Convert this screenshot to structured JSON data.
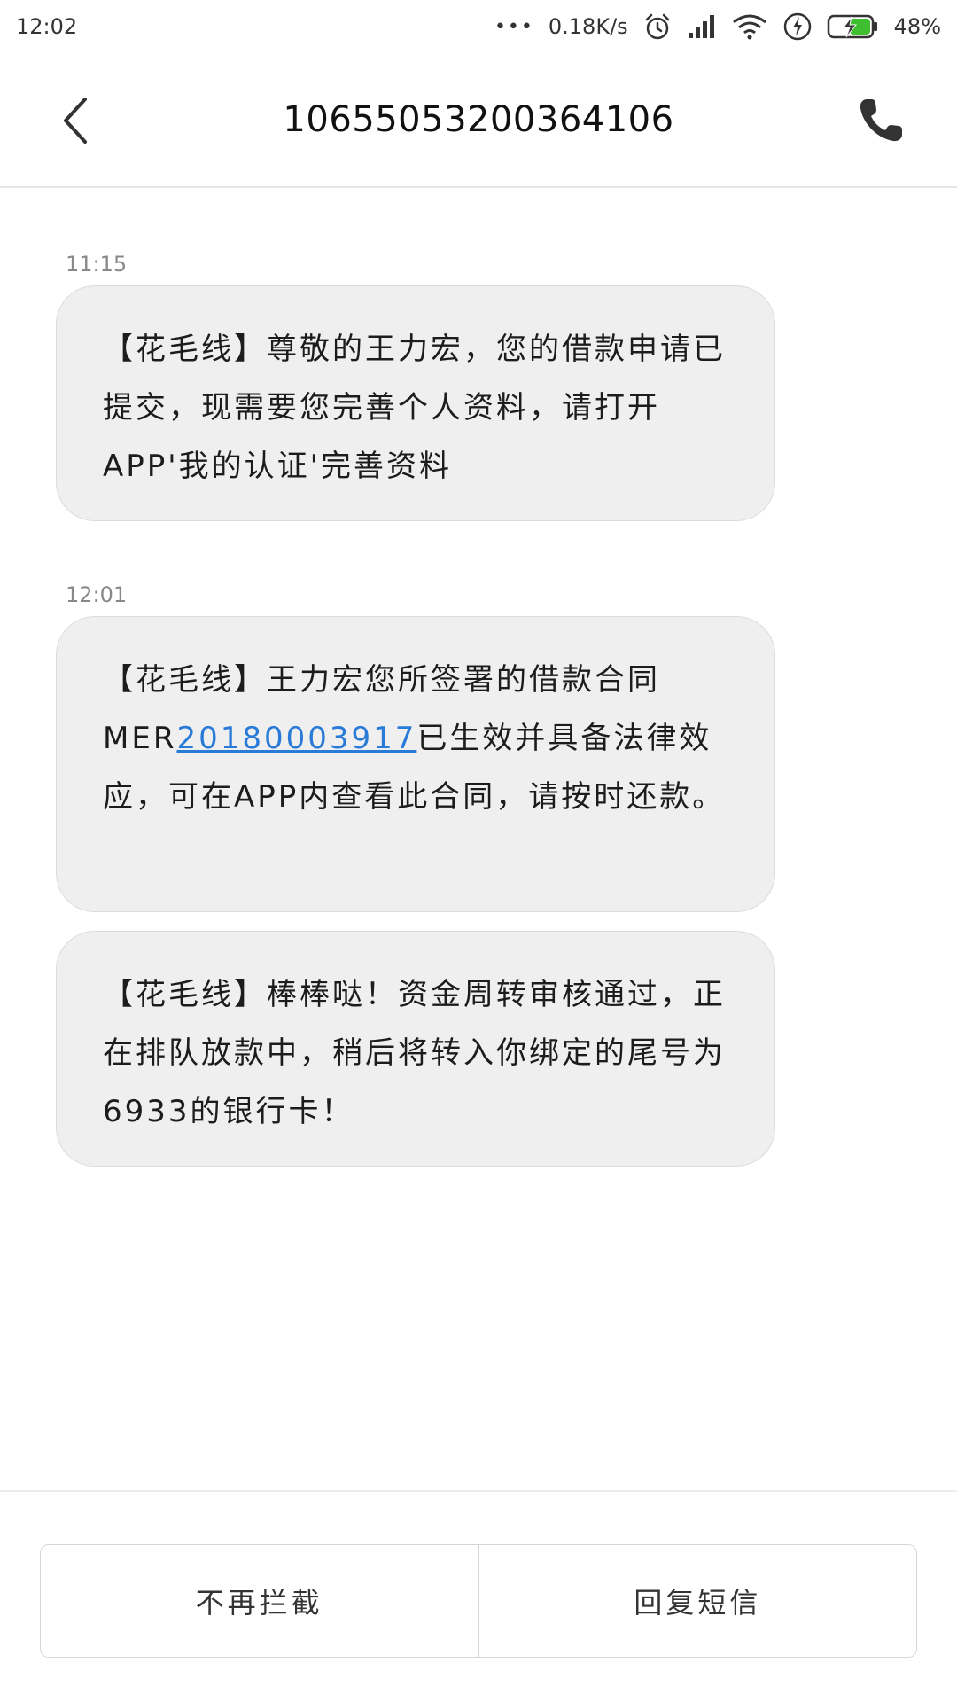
{
  "status_bar": {
    "time": "12:02",
    "dots": "•••",
    "net_speed": "0.18K/s",
    "battery_percent": "48%",
    "icons": [
      "more-dots-icon",
      "alarm-icon",
      "signal-icon",
      "wifi-icon",
      "flash-icon",
      "battery-charging-icon"
    ]
  },
  "header": {
    "title": "10655053200364106",
    "back_icon": "chevron-left-icon",
    "call_icon": "phone-icon"
  },
  "messages": [
    {
      "time": "11:15",
      "text": "【花毛线】尊敬的王力宏，您的借款申请已提交，现需要您完善个人资料，请打开APP'我的认证'完善资料"
    },
    {
      "time": "12:01",
      "text_before": "【花毛线】王力宏您所签署的借款合同MER",
      "link": "20180003917",
      "text_after": "已生效并具备法律效应，可在APP内查看此合同，请按时还款。"
    },
    {
      "time": "",
      "text": "【花毛线】棒棒哒！资金周转审核通过，正在排队放款中，稍后将转入你绑定的尾号为6933的银行卡！"
    }
  ],
  "actions": {
    "unblock_label": "不再拦截",
    "reply_label": "回复短信"
  },
  "colors": {
    "bubble_bg": "#efefef",
    "link": "#2a7bd8",
    "battery_green": "#3fbf2f"
  }
}
